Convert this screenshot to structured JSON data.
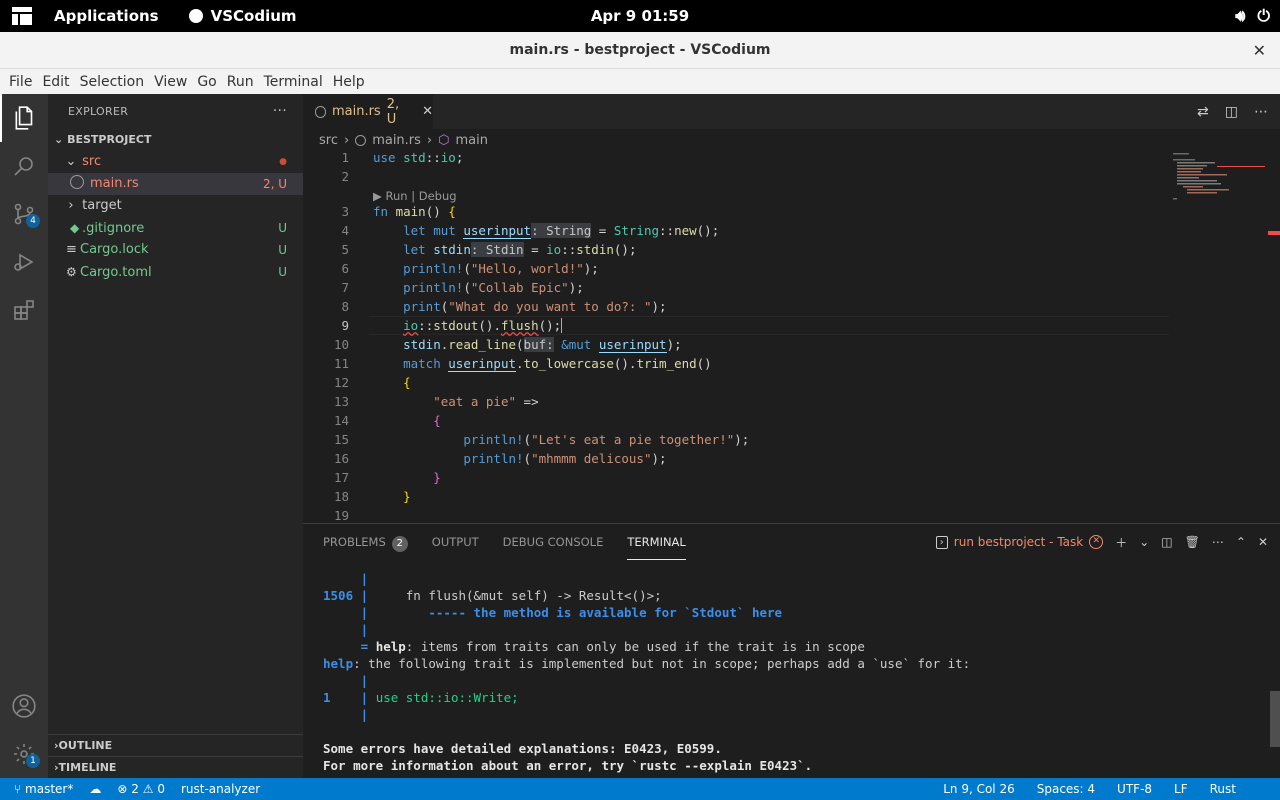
{
  "system_bar": {
    "applications": "Applications",
    "active_app": "VSCodium",
    "clock": "Apr 9  01:59"
  },
  "window": {
    "title": "main.rs - bestproject - VSCodium"
  },
  "menu": [
    "File",
    "Edit",
    "Selection",
    "View",
    "Go",
    "Run",
    "Terminal",
    "Help"
  ],
  "activity_bar": {
    "source_control_badge": "4",
    "settings_badge": "1"
  },
  "explorer": {
    "header": "EXPLORER",
    "more": "···",
    "project": "BESTPROJECT",
    "items": [
      {
        "label": "src",
        "decoration": "●",
        "color": "#f48771"
      },
      {
        "label": "main.rs",
        "decoration": "2, U",
        "color": "#f48771"
      },
      {
        "label": "target",
        "decoration": "",
        "color": "#cccccc"
      },
      {
        "label": ".gitignore",
        "decoration": "U",
        "color": "#73c991"
      },
      {
        "label": "Cargo.lock",
        "decoration": "U",
        "color": "#73c991"
      },
      {
        "label": "Cargo.toml",
        "decoration": "U",
        "color": "#73c991"
      }
    ],
    "outline": "OUTLINE",
    "timeline": "TIMELINE"
  },
  "editor": {
    "tab_label": "main.rs",
    "tab_status": "2, U",
    "breadcrumb": [
      "src",
      "main.rs",
      "main"
    ],
    "codelens": "▶ Run | Debug",
    "line_numbers": [
      "1",
      "2",
      "3",
      "4",
      "5",
      "6",
      "7",
      "8",
      "9",
      "10",
      "11",
      "12",
      "13",
      "14",
      "15",
      "16",
      "17",
      "18",
      "19"
    ],
    "current_line": "9"
  },
  "panel": {
    "tabs": [
      "PROBLEMS",
      "OUTPUT",
      "DEBUG CONSOLE",
      "TERMINAL"
    ],
    "problems_count": "2",
    "task_label": "run bestproject - Task",
    "terminal_lines": [
      "     |",
      "1506 |     fn flush(&mut self) -> Result<()>;",
      "     |        ----- the method is available for `Stdout` here",
      "     |",
      "     = help: items from traits can only be used if the trait is in scope",
      "help: the following trait is implemented but not in scope; perhaps add a `use` for it:",
      "     |",
      "1    | use std::io::Write;",
      "     |",
      "",
      "Some errors have detailed explanations: E0423, E0599.",
      "For more information about an error, try `rustc --explain E0423`."
    ]
  },
  "status_bar": {
    "branch": "master*",
    "errors": "2",
    "warnings": "0",
    "extension": "rust-analyzer",
    "position": "Ln 9, Col 26",
    "spaces": "Spaces: 4",
    "encoding": "UTF-8",
    "eol": "LF",
    "language": "Rust"
  }
}
